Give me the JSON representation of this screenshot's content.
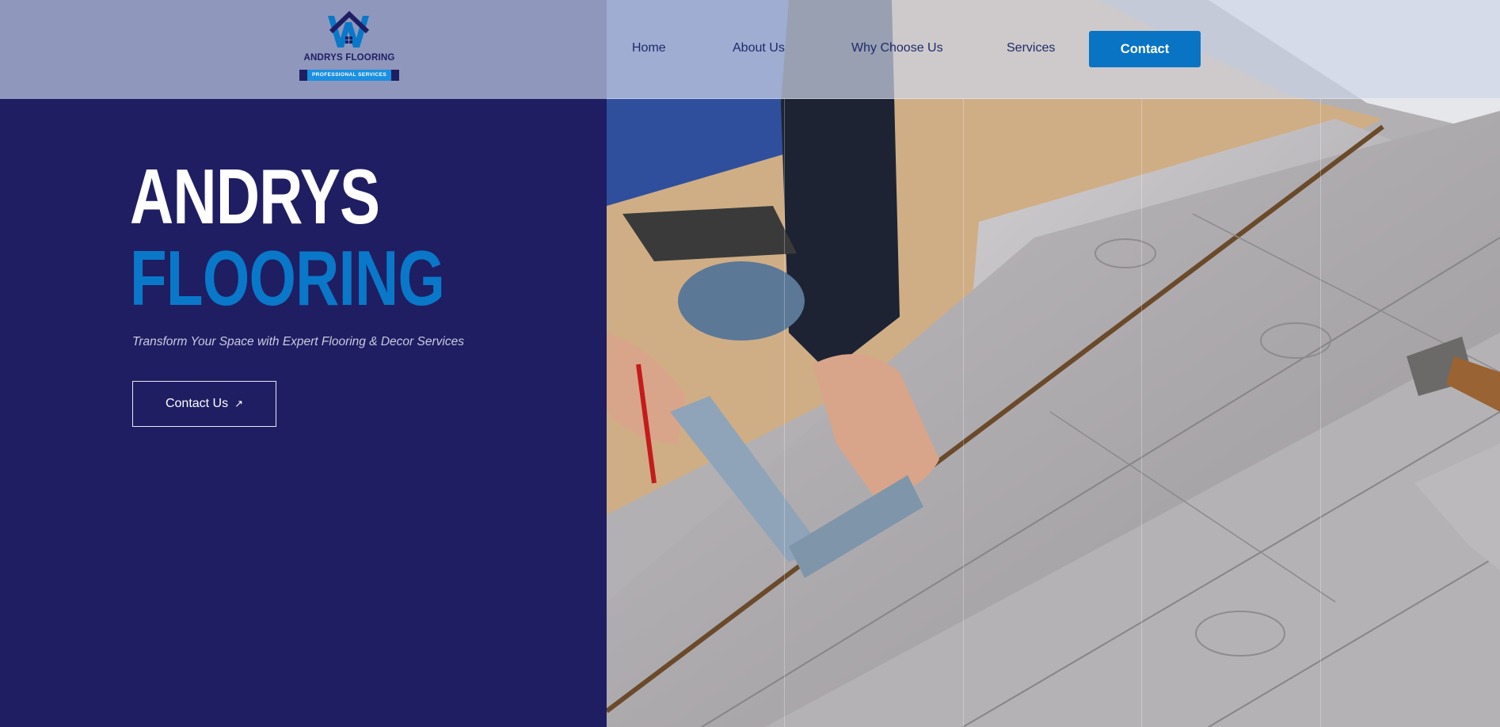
{
  "brand": {
    "logo_name": "ANDRYS FLOORING",
    "logo_tagline": "PROFESSIONAL SERVICES",
    "colors": {
      "navy": "#1f1e63",
      "blue": "#0a78c8",
      "button": "#0a74c4"
    }
  },
  "nav": {
    "items": [
      {
        "label": "Home"
      },
      {
        "label": "About Us"
      },
      {
        "label": "Why Choose Us"
      },
      {
        "label": "Services"
      }
    ],
    "contact_label": "Contact"
  },
  "hero": {
    "title_line1": "ANDRYS",
    "title_line2": "FLOORING",
    "tagline": "Transform Your Space with Expert Flooring & Decor Services",
    "cta_label": "Contact Us",
    "cta_icon": "arrow-up-right-icon"
  }
}
